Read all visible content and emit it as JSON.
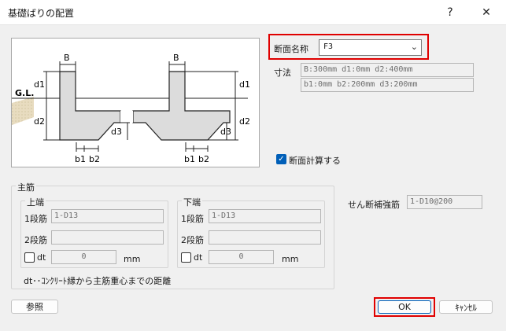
{
  "window": {
    "title": "基礎ばりの配置",
    "help": "?",
    "close": "✕"
  },
  "diagram": {
    "b": "B",
    "d1": "d1",
    "d2": "d2",
    "d3": "d3",
    "b1": "b1",
    "b2": "b2",
    "gl": "G.L."
  },
  "section": {
    "label": "断面名称",
    "value": "F3"
  },
  "dims": {
    "label": "寸法",
    "row1": "B:300mm d1:0mm d2:400mm",
    "row2": "b1:0mm b2:200mm d3:200mm"
  },
  "calc": {
    "label": "断面計算する",
    "checked": true
  },
  "main_rebar": {
    "title": "主筋",
    "upper": {
      "title": "上端",
      "row1_label": "1段筋",
      "row1_value": "1-D13",
      "row2_label": "2段筋",
      "row2_value": "",
      "dt_label": "dt",
      "dt_value": "0",
      "unit": "mm"
    },
    "lower": {
      "title": "下端",
      "row1_label": "1段筋",
      "row1_value": "1-D13",
      "row2_label": "2段筋",
      "row2_value": "",
      "dt_label": "dt",
      "dt_value": "0",
      "unit": "mm"
    },
    "note": "dt･･ｺﾝｸﾘｰﾄ縁から主筋重心までの距離"
  },
  "shear": {
    "label": "せん断補強筋",
    "value": "1-D10@200"
  },
  "buttons": {
    "ref": "参照",
    "ok": "OK",
    "cancel": "ｷｬﾝｾﾙ"
  },
  "colors": {
    "highlight": "#e00000",
    "accent": "#005fb8"
  }
}
